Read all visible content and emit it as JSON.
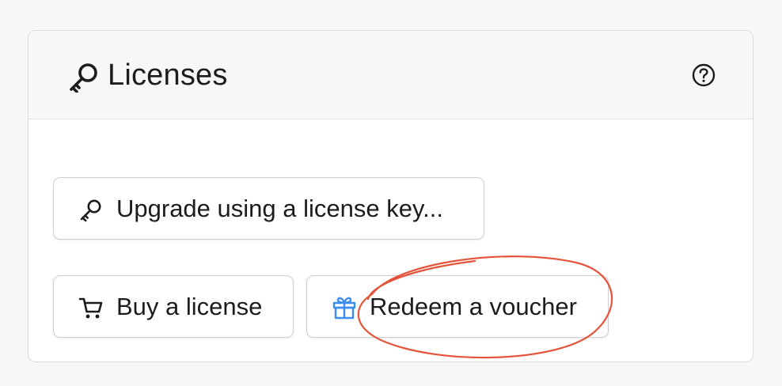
{
  "licenses_panel": {
    "title": "Licenses",
    "title_icon": "key-icon",
    "help_icon": "question-circle-icon"
  },
  "buttons": {
    "upgrade": {
      "label": "Upgrade using a license key...",
      "icon": "key-icon"
    },
    "buy": {
      "label": "Buy a license",
      "icon": "cart-icon"
    },
    "redeem": {
      "label": "Redeem a voucher",
      "icon": "gift-icon"
    }
  },
  "colors": {
    "header_background": "#f7f7f7",
    "gift_icon": "#3b8ef0",
    "annotation": "#e5533a"
  }
}
